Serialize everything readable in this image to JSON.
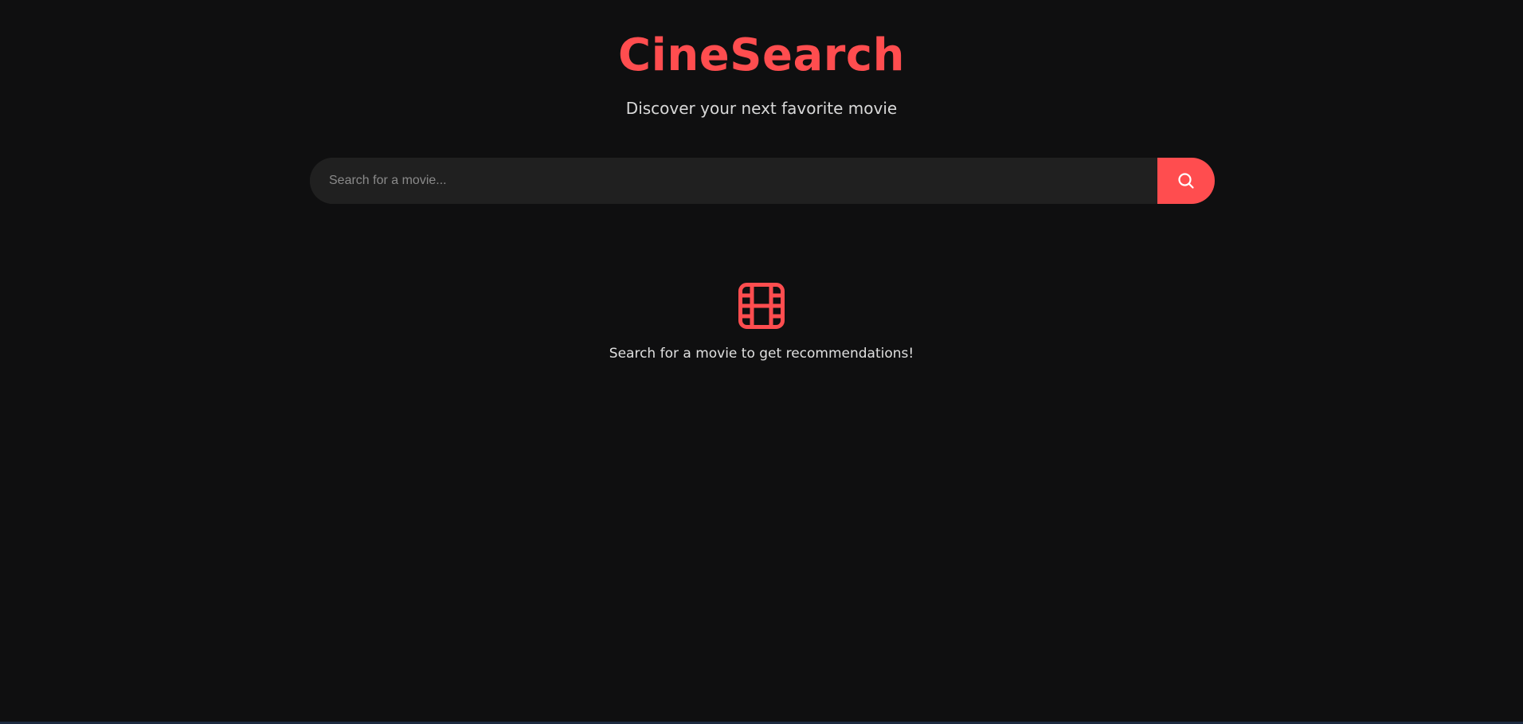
{
  "header": {
    "title": "CineSearch",
    "subtitle": "Discover your next favorite movie"
  },
  "search": {
    "placeholder": "Search for a movie...",
    "value": "",
    "button_icon": "search-icon"
  },
  "empty_state": {
    "icon": "film-icon",
    "message": "Search for a movie to get recommendations!"
  },
  "colors": {
    "background": "#0f0f10",
    "accent": "#ff4d4f",
    "input_background": "#202020",
    "text": "#e0e0e0",
    "placeholder": "#8a8a8a"
  }
}
